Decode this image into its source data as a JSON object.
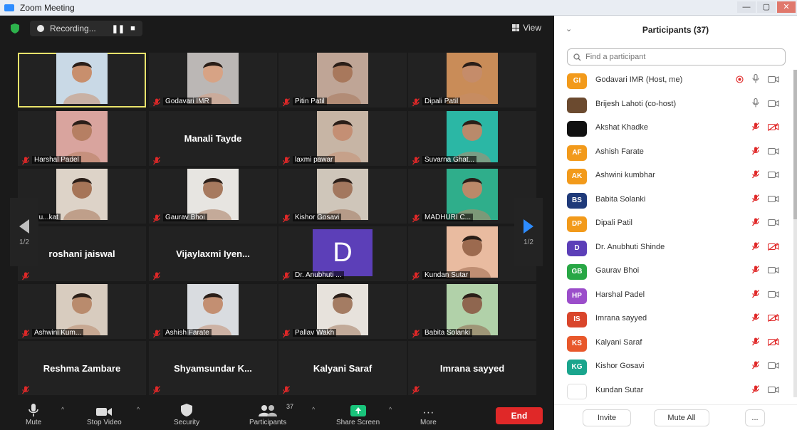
{
  "window": {
    "title": "Zoom Meeting",
    "controls": [
      "—",
      "▢",
      "✕"
    ]
  },
  "topbar": {
    "recording_label": "Recording...",
    "pause_glyph": "❚❚",
    "stop_glyph": "■",
    "view_label": "View"
  },
  "colors": {
    "speaker_highlight": "#e9e36b",
    "muted_red": "#e02828",
    "end_button": "#e02828",
    "avatar_purple": "#5c3fb8",
    "share_green": "#19c47b"
  },
  "tiles": [
    {
      "name": "",
      "type": "video",
      "bg": "#c9d9e6",
      "skin": "#c88f6d",
      "speaker": true
    },
    {
      "name": "Godavari IMR",
      "type": "video",
      "bg": "#bbb7b5",
      "skin": "#d7a385"
    },
    {
      "name": "Pitin Patil",
      "type": "video",
      "bg": "#bfa596",
      "skin": "#a8785c"
    },
    {
      "name": "Dipali Patil",
      "type": "video",
      "bg": "#c98c58",
      "skin": "#c58c6a"
    },
    {
      "name": "Harshal Padel",
      "type": "video",
      "bg": "#d9a49e",
      "skin": "#b67f63"
    },
    {
      "name": "Manali Tayde",
      "type": "name"
    },
    {
      "name": "laxmi pawar",
      "type": "video",
      "bg": "#c7b5a5",
      "skin": "#c48f74"
    },
    {
      "name": "Suvarna Ghat...",
      "type": "video",
      "bg": "#2bb7a5",
      "skin": "#b98a6b"
    },
    {
      "name": "Pu...kat",
      "type": "video",
      "bg": "#ddd3c8",
      "skin": "#a67558"
    },
    {
      "name": "Gaurav Bhoi",
      "type": "video",
      "bg": "#e7e5e1",
      "skin": "#a77a5f"
    },
    {
      "name": "Kishor Gosavi",
      "type": "video",
      "bg": "#cfc6ba",
      "skin": "#a3785f"
    },
    {
      "name": "MADHURI C...",
      "type": "video",
      "bg": "#2fae8b",
      "skin": "#bb8969"
    },
    {
      "name": "roshani jaiswal",
      "type": "name"
    },
    {
      "name": "Vijaylaxmi Iyen...",
      "type": "name"
    },
    {
      "name": "Dr. Anubhuti ...",
      "type": "letter",
      "letter": "D"
    },
    {
      "name": "Kundan Sutar",
      "type": "video",
      "bg": "#e9bba0",
      "skin": "#9c6a4f"
    },
    {
      "name": "Ashwini Kum...",
      "type": "video",
      "bg": "#d8ccbf",
      "skin": "#b98b6d"
    },
    {
      "name": "Ashish Farate",
      "type": "video",
      "bg": "#d9dce0",
      "skin": "#c38f72"
    },
    {
      "name": "Pallav Wakh",
      "type": "video",
      "bg": "#e7e2dc",
      "skin": "#a47c63"
    },
    {
      "name": "Babita Solanki",
      "type": "video",
      "bg": "#b1d1a9",
      "skin": "#8f664f"
    },
    {
      "name": "Reshma Zambare",
      "type": "name"
    },
    {
      "name": "Shyamsundar K...",
      "type": "name"
    },
    {
      "name": "Kalyani Saraf",
      "type": "name"
    },
    {
      "name": "Imrana sayyed",
      "type": "name"
    }
  ],
  "pager": {
    "left_label": "1/2",
    "right_label": "1/2"
  },
  "toolbar": {
    "mute": "Mute",
    "stop_video": "Stop Video",
    "security": "Security",
    "participants": "Participants",
    "participants_count": "37",
    "share_screen": "Share Screen",
    "more": "More",
    "end": "End"
  },
  "panel": {
    "title": "Participants (37)",
    "search_placeholder": "Find a participant",
    "participants": [
      {
        "initials": "GI",
        "name": "Godavari IMR (Host, me)",
        "color": "#f29a1b",
        "mic": "on",
        "video": "on",
        "recording": true
      },
      {
        "initials": "",
        "name": "Brijesh Lahoti (co-host)",
        "color": "#6b4a2f",
        "mic": "on",
        "video": "on"
      },
      {
        "initials": "",
        "name": "Akshat Khadke",
        "color": "#111111",
        "mic": "muted",
        "video": "off"
      },
      {
        "initials": "AF",
        "name": "Ashish Farate",
        "color": "#f29a1b",
        "mic": "muted",
        "video": "on"
      },
      {
        "initials": "AK",
        "name": "Ashwini kumbhar",
        "color": "#f29a1b",
        "mic": "muted",
        "video": "on"
      },
      {
        "initials": "BS",
        "name": "Babita Solanki",
        "color": "#1f3a7a",
        "mic": "muted",
        "video": "on"
      },
      {
        "initials": "DP",
        "name": "Dipali Patil",
        "color": "#f29a1b",
        "mic": "muted",
        "video": "on"
      },
      {
        "initials": "D",
        "name": "Dr. Anubhuti Shinde",
        "color": "#5c3fb8",
        "mic": "muted",
        "video": "off"
      },
      {
        "initials": "GB",
        "name": "Gaurav Bhoi",
        "color": "#28a745",
        "mic": "muted",
        "video": "on"
      },
      {
        "initials": "HP",
        "name": "Harshal Padel",
        "color": "#9b4dca",
        "mic": "muted",
        "video": "on"
      },
      {
        "initials": "IS",
        "name": "Imrana sayyed",
        "color": "#d9452b",
        "mic": "muted",
        "video": "off"
      },
      {
        "initials": "KS",
        "name": "Kalyani Saraf",
        "color": "#e8582b",
        "mic": "muted",
        "video": "off"
      },
      {
        "initials": "KG",
        "name": "Kishor Gosavi",
        "color": "#1aa58d",
        "mic": "muted",
        "video": "on"
      },
      {
        "initials": "",
        "name": "Kundan Sutar",
        "color": "#ffffff",
        "mic": "muted",
        "video": "on"
      }
    ],
    "invite": "Invite",
    "mute_all": "Mute All",
    "more": "..."
  }
}
